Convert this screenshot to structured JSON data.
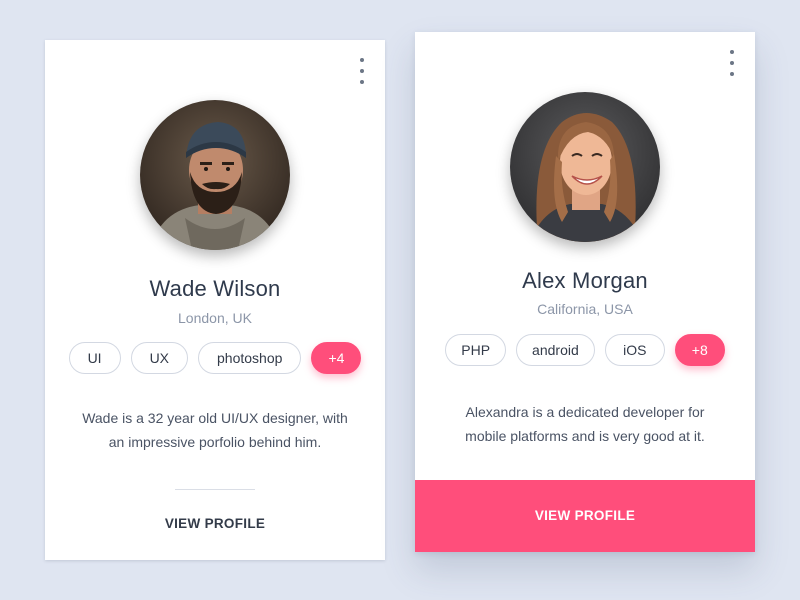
{
  "cards": [
    {
      "name": "Wade Wilson",
      "location": "London, UK",
      "tags": [
        "UI",
        "UX",
        "photoshop"
      ],
      "more_tags": "+4",
      "bio": "Wade is a 32 year old UI/UX designer, with an impressive porfolio behind him.",
      "action_label": "VIEW PROFILE"
    },
    {
      "name": "Alex Morgan",
      "location": "California, USA",
      "tags": [
        "PHP",
        "android",
        "iOS"
      ],
      "more_tags": "+8",
      "bio": "Alexandra is a dedicated developer for mobile platforms and is very good at it.",
      "action_label": "VIEW PROFILE"
    }
  ],
  "colors": {
    "background": "#dfe5f1",
    "accent": "#ff4e7b",
    "card": "#ffffff",
    "name_text": "#2f3a4c",
    "muted_text": "#8c96a8"
  }
}
